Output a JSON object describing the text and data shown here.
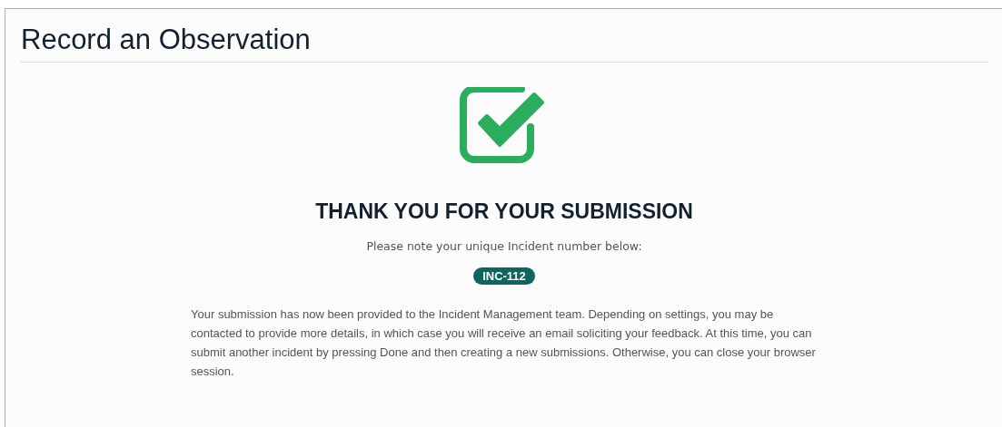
{
  "page": {
    "title": "Record an Observation"
  },
  "confirmation": {
    "heading": "THANK YOU FOR YOUR SUBMISSION",
    "note": "Please note your unique Incident number below:",
    "incident_number": "INC-112",
    "message": "Your submission has now been provided to the Incident Management team. Depending on settings, you may be contacted to provide more details, in which case you will receive an email soliciting your feedback. At this time, you can submit another incident by pressing Done and then creating a new submissions. Otherwise, you can close your browser session."
  }
}
